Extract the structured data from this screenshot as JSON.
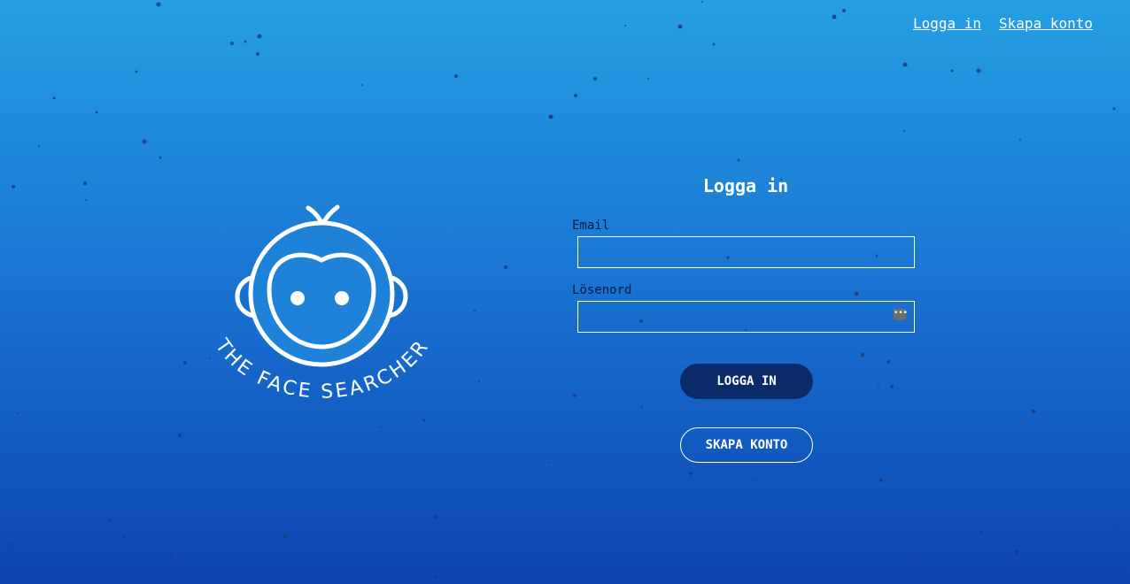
{
  "nav": {
    "login_link": "Logga in",
    "signup_link": "Skapa konto"
  },
  "logo": {
    "text": "THE FACE SEARCHER"
  },
  "login_form": {
    "title": "Logga in",
    "email_label": "Email",
    "email_value": "",
    "password_label": "Lösenord",
    "password_value": "",
    "submit_label": "LOGGA IN",
    "signup_label": "SKAPA KONTO"
  },
  "icons": {
    "password_manager": "password-dots-icon"
  },
  "colors": {
    "background_top": "#259fe2",
    "background_bottom": "#0c44b1",
    "primary_button": "#0a2a6a",
    "dots": "#1f3a7a"
  }
}
